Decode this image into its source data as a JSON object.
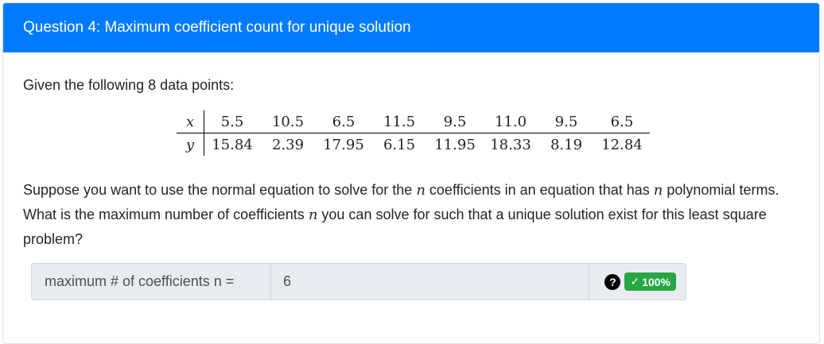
{
  "header": {
    "title": "Question 4: Maximum coefficient count for unique solution"
  },
  "intro": "Given the following 8 data points:",
  "table": {
    "x_label": "x",
    "y_label": "y",
    "x": [
      "5.5",
      "10.5",
      "6.5",
      "11.5",
      "9.5",
      "11.0",
      "9.5",
      "6.5"
    ],
    "y": [
      "15.84",
      "2.39",
      "17.95",
      "6.15",
      "11.95",
      "18.33",
      "8.19",
      "12.84"
    ]
  },
  "question": {
    "part1": "Suppose you want to use the normal equation to solve for the ",
    "var": "n",
    "part2": " coefficients in an equation that has ",
    "part3": " polynomial terms. What is the maximum number of coefficients ",
    "part4": " you can solve for such that a unique solution exist for this least square problem?"
  },
  "answer": {
    "label": "maximum # of coefficients n =",
    "value": "6",
    "help": "?",
    "check": "✓",
    "score": "100%"
  },
  "colors": {
    "header_bg": "#007bff",
    "badge_green": "#28a745"
  }
}
